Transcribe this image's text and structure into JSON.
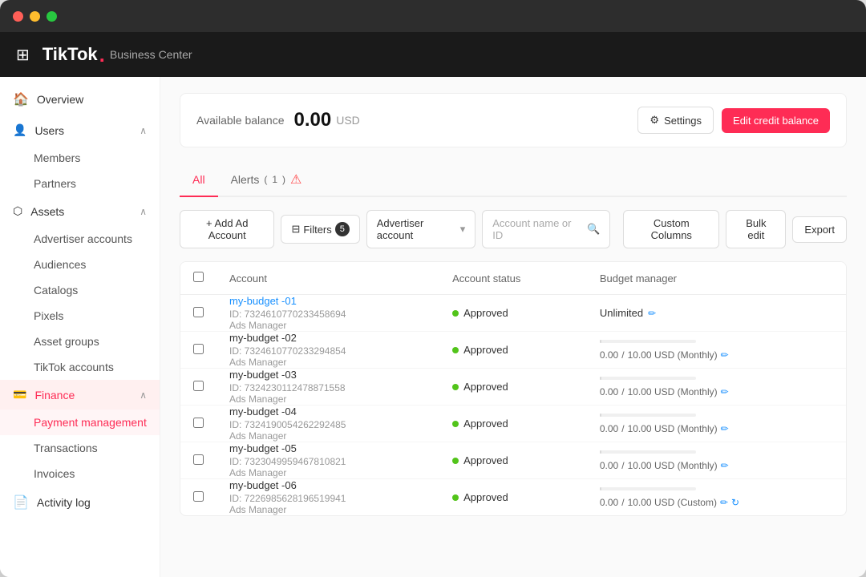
{
  "window": {
    "title": "TikTok Business Center"
  },
  "header": {
    "logo_text": "TikTok",
    "logo_separator": ".",
    "subtitle": "Business Center"
  },
  "sidebar": {
    "overview_label": "Overview",
    "users_label": "Users",
    "members_label": "Members",
    "partners_label": "Partners",
    "assets_label": "Assets",
    "advertiser_accounts_label": "Advertiser accounts",
    "audiences_label": "Audiences",
    "catalogs_label": "Catalogs",
    "pixels_label": "Pixels",
    "asset_groups_label": "Asset groups",
    "tiktok_accounts_label": "TikTok accounts",
    "finance_label": "Finance",
    "payment_management_label": "Payment management",
    "transactions_label": "Transactions",
    "invoices_label": "Invoices",
    "activity_log_label": "Activity log"
  },
  "balance": {
    "label": "Available balance",
    "amount": "0.00",
    "currency": "USD",
    "settings_label": "Settings",
    "edit_credit_label": "Edit credit balance"
  },
  "tabs": {
    "all_label": "All",
    "alerts_label": "Alerts",
    "alerts_count": "1"
  },
  "toolbar": {
    "add_account_label": "+ Add Ad Account",
    "filters_label": "Filters",
    "filters_count": "5",
    "advertiser_account_label": "Advertiser account",
    "search_placeholder": "Account name or ID",
    "custom_columns_label": "Custom Columns",
    "bulk_edit_label": "Bulk edit",
    "export_label": "Export"
  },
  "table": {
    "headers": [
      "",
      "Account",
      "Account status",
      "Budget manager"
    ],
    "rows": [
      {
        "name": "my-budget -01",
        "id": "ID: 7324610770233458694",
        "type": "Ads Manager",
        "status": "Approved",
        "budget_type": "unlimited",
        "budget_value": "Unlimited"
      },
      {
        "name": "my-budget -02",
        "id": "ID: 7324610770233294854",
        "type": "Ads Manager",
        "status": "Approved",
        "budget_type": "bar",
        "budget_current": "0.00",
        "budget_max": "10.00 USD (Monthly)"
      },
      {
        "name": "my-budget -03",
        "id": "ID: 7324230112478871558",
        "type": "Ads Manager",
        "status": "Approved",
        "budget_type": "bar",
        "budget_current": "0.00",
        "budget_max": "10.00 USD (Monthly)"
      },
      {
        "name": "my-budget -04",
        "id": "ID: 7324190054262292485",
        "type": "Ads Manager",
        "status": "Approved",
        "budget_type": "bar",
        "budget_current": "0.00",
        "budget_max": "10.00 USD (Monthly)"
      },
      {
        "name": "my-budget -05",
        "id": "ID: 7323049959467810821",
        "type": "Ads Manager",
        "status": "Approved",
        "budget_type": "bar",
        "budget_current": "0.00",
        "budget_max": "10.00 USD (Monthly)"
      },
      {
        "name": "my-budget -06",
        "id": "ID: 7226985628196519941",
        "type": "Ads Manager",
        "status": "Approved",
        "budget_type": "bar_custom",
        "budget_current": "0.00",
        "budget_max": "10.00 USD (Custom)"
      }
    ]
  }
}
